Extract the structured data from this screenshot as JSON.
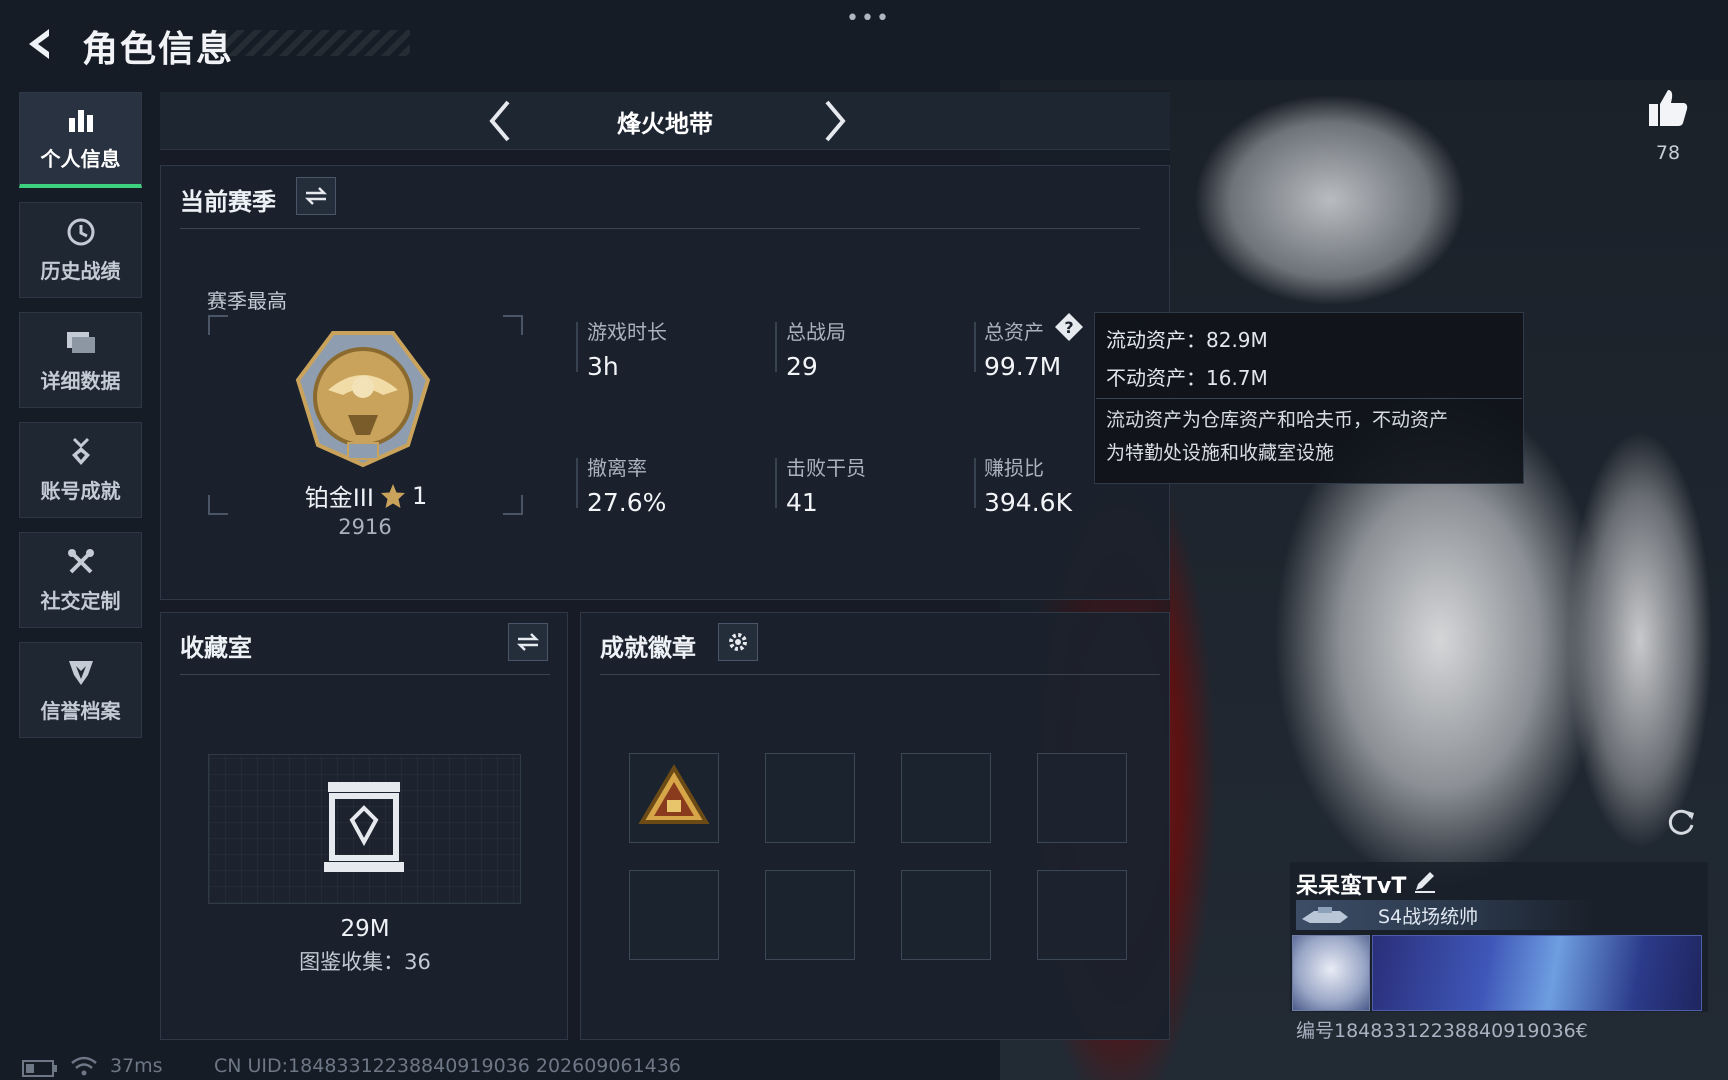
{
  "top": {
    "title": "角色信息",
    "menu_dots": "•••"
  },
  "sidebar": {
    "items": [
      {
        "label": "个人信息",
        "icon": "bar-chart-icon",
        "active": true
      },
      {
        "label": "历史战绩",
        "icon": "history-clock-icon",
        "active": false
      },
      {
        "label": "详细数据",
        "icon": "folder-icon",
        "active": false
      },
      {
        "label": "账号成就",
        "icon": "medal-icon",
        "active": false
      },
      {
        "label": "社交定制",
        "icon": "tools-icon",
        "active": false
      },
      {
        "label": "信誉档案",
        "icon": "shield-heart-icon",
        "active": false
      }
    ]
  },
  "mode": {
    "title": "烽火地带"
  },
  "season": {
    "title": "当前赛季",
    "best_label": "赛季最高",
    "rank_name": "铂金III",
    "rank_stars": "1",
    "rank_points": "2916",
    "stats": [
      {
        "label": "游戏时长",
        "value": "3h"
      },
      {
        "label": "总战局",
        "value": "29"
      },
      {
        "label": "总资产",
        "value": "99.7M"
      },
      {
        "label": "撤离率",
        "value": "27.6%"
      },
      {
        "label": "击败干员",
        "value": "41"
      },
      {
        "label": "赚损比",
        "value": "394.6K"
      }
    ]
  },
  "tooltip": {
    "liquid": "流动资产：82.9M",
    "fixed": "不动资产：16.7M",
    "desc_line1": "流动资产为仓库资产和哈夫币，不动资产",
    "desc_line2": "为特勤处设施和收藏室设施"
  },
  "collection": {
    "title": "收藏室",
    "value": "29M",
    "caption": "图鉴收集：36"
  },
  "badges": {
    "title": "成就徽章"
  },
  "player": {
    "name": "呆呆蛮TvT",
    "title": "S4战场统帅",
    "id_text": "编号18483312238840919036€"
  },
  "likes": {
    "count": "78"
  },
  "footer": {
    "ping": "37ms",
    "uid": "CN UID:18483312238840919036 202609061436"
  },
  "colors": {
    "accent_green": "#3ed17d",
    "panel_bg": "#1b222c",
    "gold": "#c9a35c"
  }
}
